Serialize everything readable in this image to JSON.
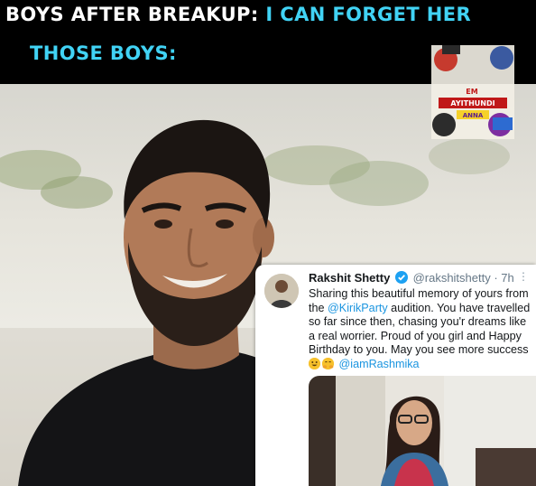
{
  "caption": {
    "line1_prefix": "BOYS AFTER BREAKUP:",
    "line1_highlight": "I CAN FORGET HER",
    "line2": "THOSE BOYS:"
  },
  "logo": {
    "text_line1": "EM",
    "text_line2": "AYITHUNDI",
    "text_line3": "ANNA"
  },
  "tweet": {
    "name": "Rakshit Shetty",
    "handle": "@rakshitshetty",
    "time": "· 7h",
    "more": "⋮",
    "body_part1": "Sharing this beautiful memory of yours from the ",
    "mention1": "@KirikParty",
    "body_part2": " audition. You have travelled so far since then, chasing you'r dreams like a real worrier. Proud of you girl and Happy Birthday to you. May you see more success ",
    "mention2": "@iamRashmika"
  },
  "colors": {
    "caption_white": "#ffffff",
    "caption_cyan": "#41d3f5",
    "twitter_blue": "#1b95e0"
  }
}
